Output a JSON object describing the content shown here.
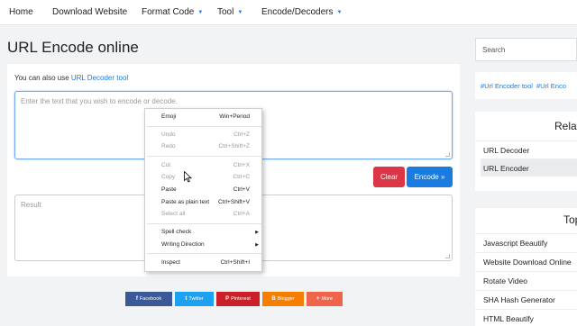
{
  "nav": {
    "items": [
      {
        "label": "Home",
        "dropdown": false
      },
      {
        "label": "Download Website",
        "dropdown": false
      },
      {
        "label": "Format Code",
        "dropdown": true
      },
      {
        "label": "Tool",
        "dropdown": true
      },
      {
        "label": "Encode/Decoders",
        "dropdown": true
      }
    ],
    "caret_icon": "caret-down-icon"
  },
  "page": {
    "title": "URL Encode online"
  },
  "main": {
    "hint_prefix": "You can also use",
    "hint_link": "URL Decoder tool",
    "input_placeholder": "Enter the text that you wish to encode or decode.",
    "clear_label": "Clear",
    "encode_label": "Encode »",
    "result_placeholder": "Result"
  },
  "share": [
    {
      "label": "Facebook",
      "icon": "f",
      "color": "#3b5998"
    },
    {
      "label": "Twitter",
      "icon": "t",
      "color": "#1da1f2"
    },
    {
      "label": "Pinterest",
      "icon": "P",
      "color": "#cb2027"
    },
    {
      "label": "Blogger",
      "icon": "B",
      "color": "#f57d00"
    },
    {
      "label": "More",
      "icon": "+",
      "color": "#f0644c"
    }
  ],
  "sidebar": {
    "search_placeholder": "Search",
    "tags": [
      "#Url Encoder tool",
      "#Url Enco"
    ],
    "related": {
      "heading": "Relat",
      "items": [
        "URL Decoder",
        "URL Encoder"
      ],
      "active_index": 1
    },
    "top": {
      "heading": "Top",
      "items": [
        "Javascript Beautify",
        "Website Download Online",
        "Rotate Video",
        "SHA Hash Generator",
        "HTML Beautify"
      ]
    }
  },
  "context_menu": {
    "items": [
      {
        "label": "Emoji",
        "shortcut": "Win+Period",
        "disabled": false
      },
      {
        "label": "Undo",
        "shortcut": "Ctrl+Z",
        "disabled": true
      },
      {
        "label": "Redo",
        "shortcut": "Ctrl+Shift+Z",
        "disabled": true
      },
      {
        "label": "Cut",
        "shortcut": "Ctrl+X",
        "disabled": true
      },
      {
        "label": "Copy",
        "shortcut": "Ctrl+C",
        "disabled": true
      },
      {
        "label": "Paste",
        "shortcut": "Ctrl+V",
        "disabled": false
      },
      {
        "label": "Paste as plain text",
        "shortcut": "Ctrl+Shift+V",
        "disabled": false
      },
      {
        "label": "Select all",
        "shortcut": "Ctrl+A",
        "disabled": true
      },
      {
        "label": "Spell check",
        "submenu": true,
        "disabled": false
      },
      {
        "label": "Writing Direction",
        "submenu": true,
        "disabled": false
      },
      {
        "label": "Inspect",
        "shortcut": "Ctrl+Shift+I",
        "disabled": false
      }
    ]
  },
  "colors": {
    "accent": "#1a7be0",
    "danger": "#dc3545",
    "background": "#f2f3f5"
  }
}
